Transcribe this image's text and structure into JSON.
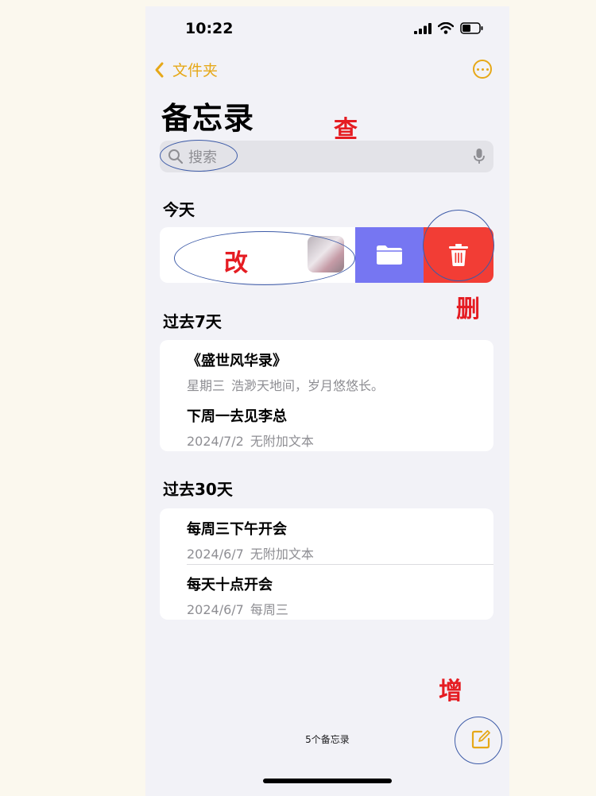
{
  "status_bar": {
    "time": "10:22"
  },
  "nav": {
    "back_label": "文件夹"
  },
  "page": {
    "title": "备忘录"
  },
  "search": {
    "placeholder": "搜索"
  },
  "sections": {
    "today": "今天",
    "past_7": "过去7天",
    "past_30": "过去30天"
  },
  "past_7_notes": [
    {
      "title": "《盛世风华录》",
      "date": "星期三",
      "preview": "浩渺天地间，岁月悠悠长。"
    },
    {
      "title": "下周一去见李总",
      "date": "2024/7/2",
      "preview": "无附加文本"
    }
  ],
  "past_30_notes": [
    {
      "title": "每周三下午开会",
      "date": "2024/6/7",
      "preview": "无附加文本"
    },
    {
      "title": "每天十点开会",
      "date": "2024/6/7",
      "preview": "每周三"
    }
  ],
  "footer": {
    "count_label": "5个备忘录"
  },
  "annotations": {
    "search": "查",
    "edit": "改",
    "delete": "删",
    "add": "增"
  },
  "colors": {
    "accent": "#e6a818",
    "folder_action": "#7676f2",
    "delete_action": "#f23d35",
    "annotation_text": "#e51c22",
    "annotation_ring": "#3d5ba8"
  },
  "icons": [
    "chevron-left-icon",
    "ellipsis-circle-icon",
    "search-icon",
    "microphone-icon",
    "folder-icon",
    "trash-icon",
    "compose-icon"
  ]
}
